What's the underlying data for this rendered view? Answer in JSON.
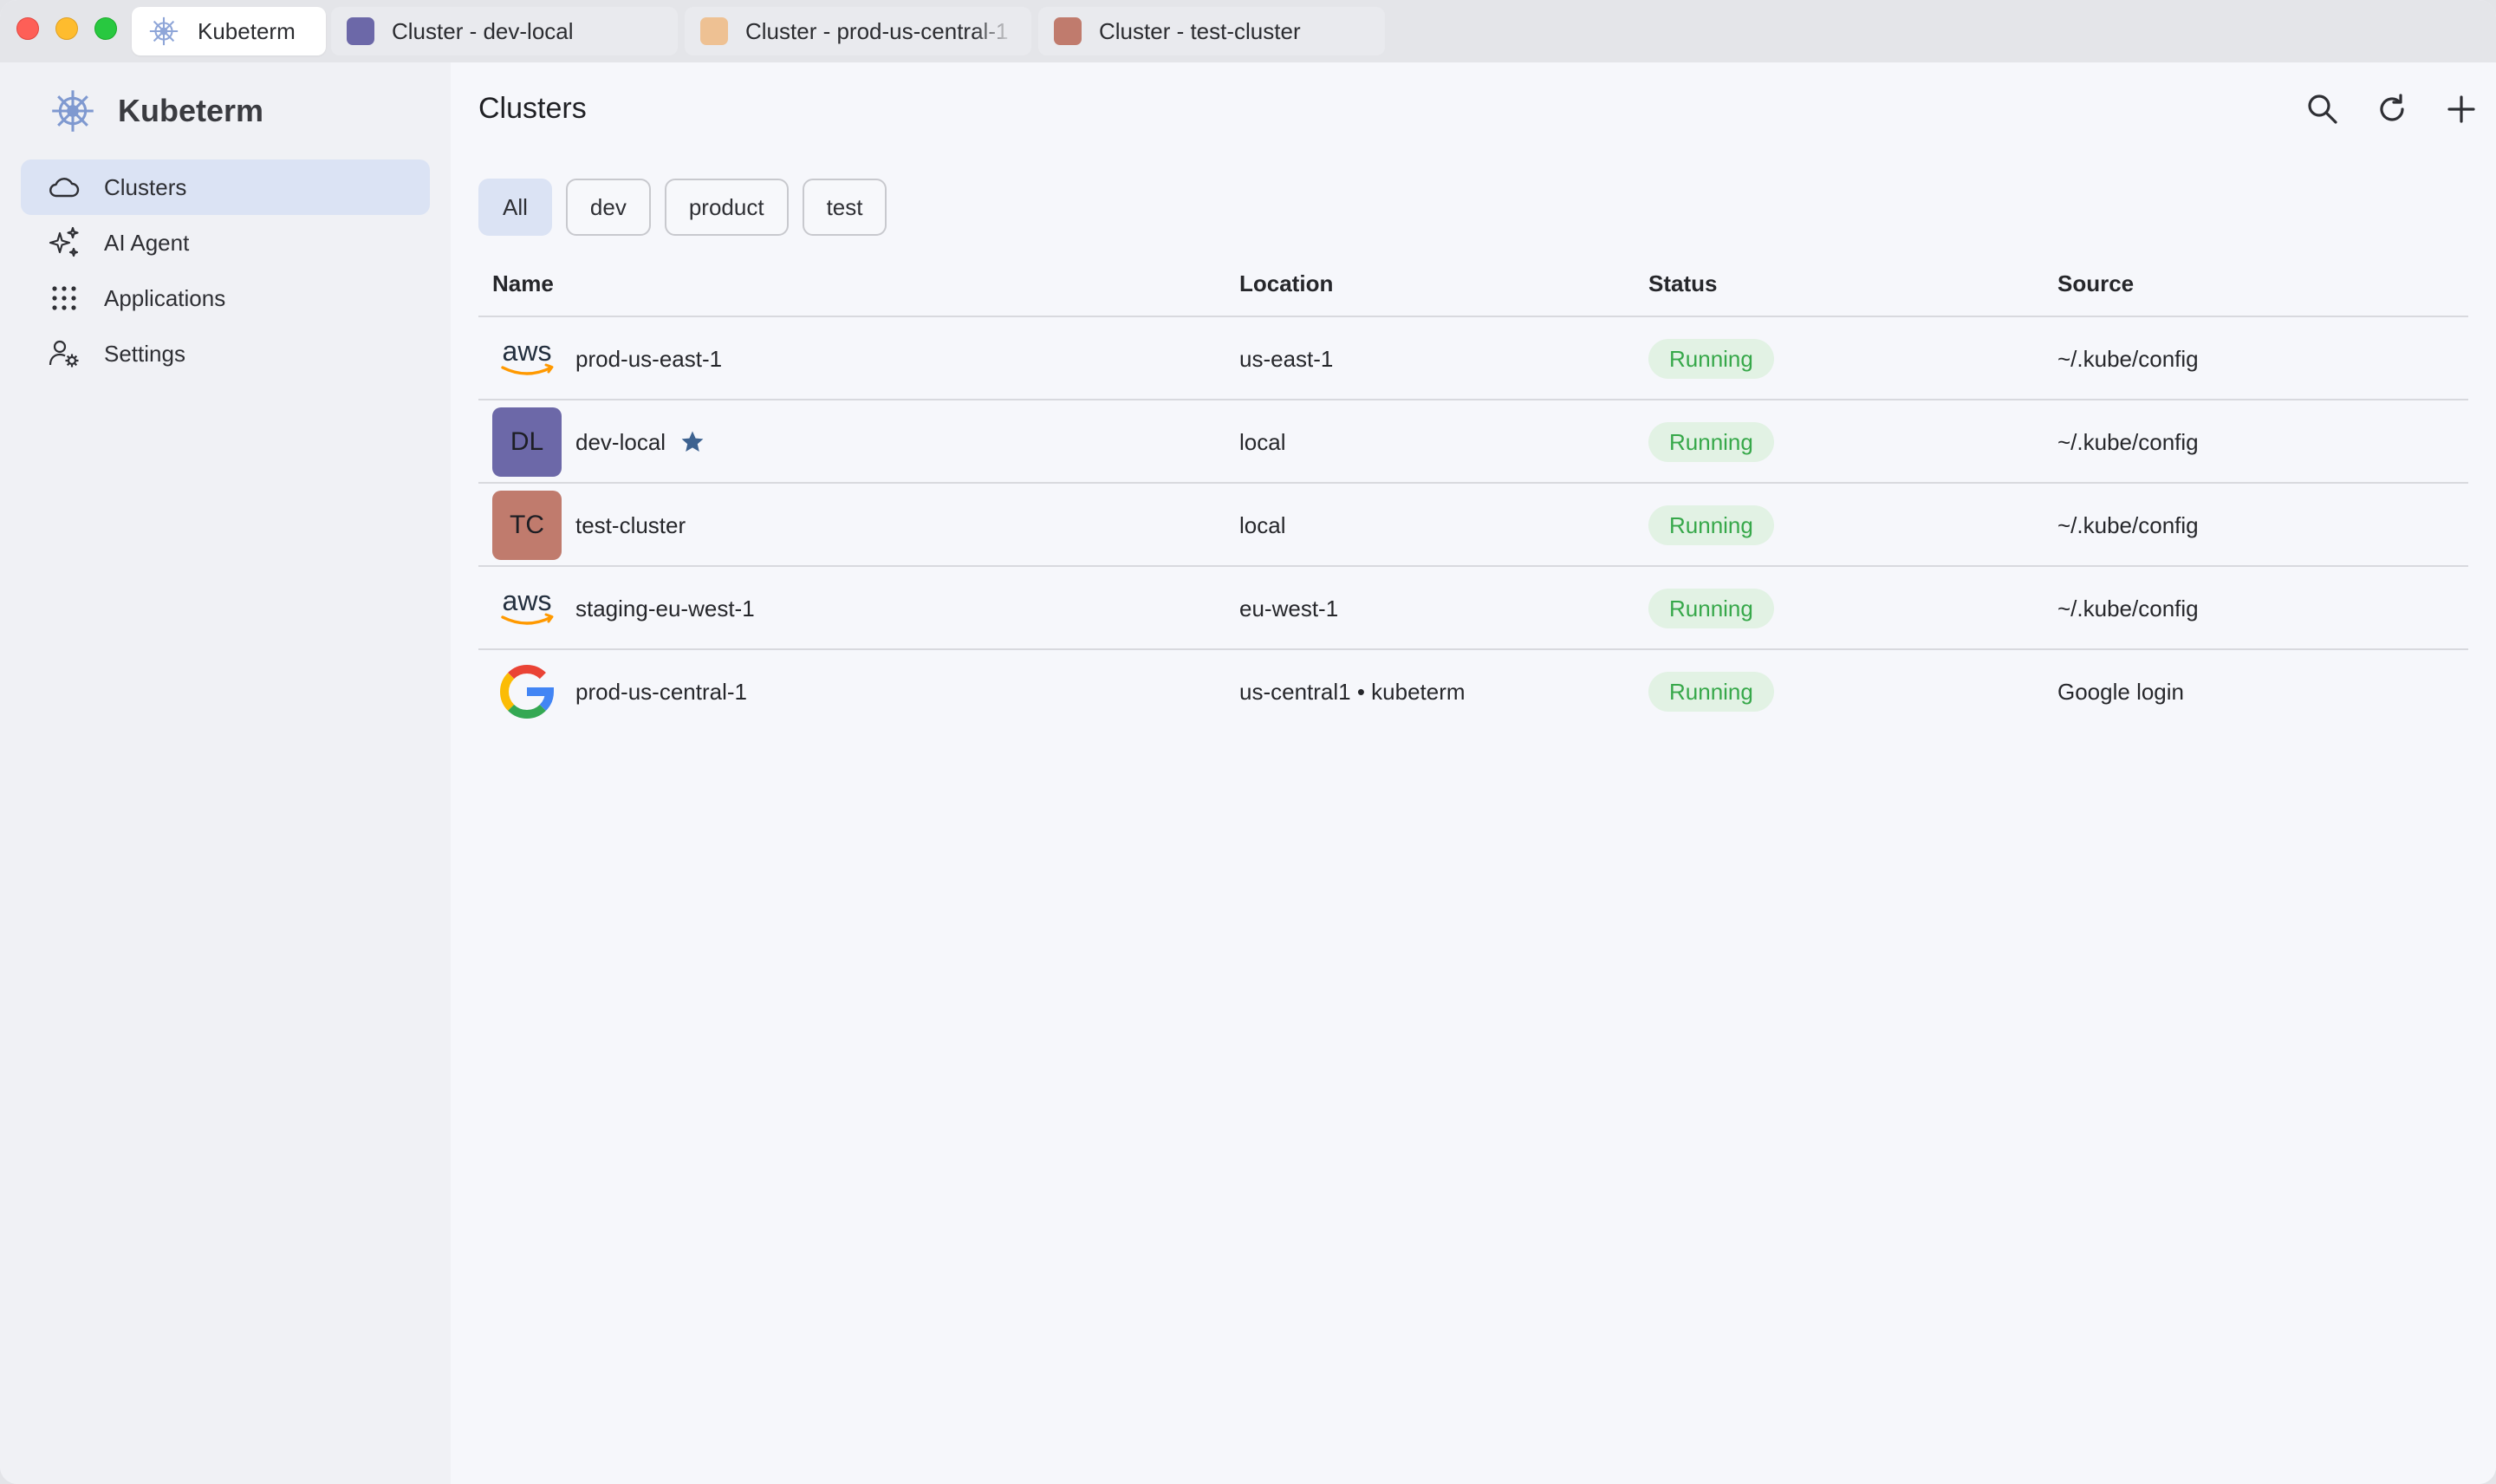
{
  "window": {
    "tabs": [
      {
        "label": "Kubeterm",
        "icon": "kubeterm-logo-icon",
        "active": true
      },
      {
        "label": "Cluster - dev-local",
        "color": "#6c68a8"
      },
      {
        "label": "Cluster - prod-us-central-1",
        "color": "#eec193"
      },
      {
        "label": "Cluster - test-cluster",
        "color": "#c07b6d"
      }
    ]
  },
  "sidebar": {
    "brand": "Kubeterm",
    "items": [
      {
        "label": "Clusters",
        "icon": "cloud-icon",
        "selected": true
      },
      {
        "label": "AI Agent",
        "icon": "sparkle-icon"
      },
      {
        "label": "Applications",
        "icon": "grid-icon"
      },
      {
        "label": "Settings",
        "icon": "user-settings-icon"
      }
    ]
  },
  "main": {
    "title": "Clusters",
    "toolbar": {
      "search_icon": "search-icon",
      "refresh_icon": "refresh-icon",
      "add_icon": "plus-icon"
    },
    "filters": [
      {
        "label": "All",
        "selected": true
      },
      {
        "label": "dev"
      },
      {
        "label": "product"
      },
      {
        "label": "test"
      }
    ],
    "columns": [
      "Name",
      "Location",
      "Status",
      "Source"
    ],
    "rows": [
      {
        "name": "prod-us-east-1",
        "provider": "aws",
        "location": "us-east-1",
        "status": "Running",
        "source": "~/.kube/config"
      },
      {
        "name": "dev-local",
        "avatar": "DL",
        "avatar_color": "#6c68a8",
        "favorite": true,
        "location": "local",
        "status": "Running",
        "source": "~/.kube/config"
      },
      {
        "name": "test-cluster",
        "avatar": "TC",
        "avatar_color": "#c07b6d",
        "location": "local",
        "status": "Running",
        "source": "~/.kube/config"
      },
      {
        "name": "staging-eu-west-1",
        "provider": "aws",
        "location": "eu-west-1",
        "status": "Running",
        "source": "~/.kube/config"
      },
      {
        "name": "prod-us-central-1",
        "provider": "google",
        "location": "us-central1 • kubeterm",
        "status": "Running",
        "source": "Google login"
      }
    ]
  },
  "colors": {
    "accent": "#dbe3f4",
    "running_bg": "#e2f2e4",
    "running_text": "#37a84a",
    "star": "#3d6290"
  }
}
